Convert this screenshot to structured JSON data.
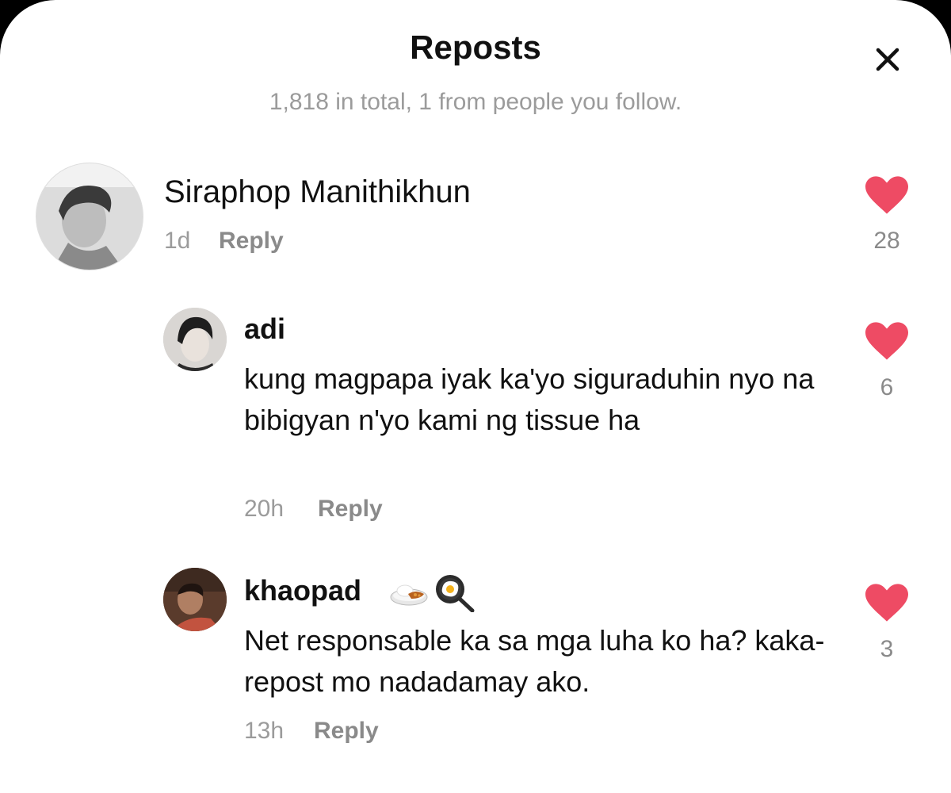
{
  "header": {
    "title": "Reposts",
    "subtitle": "1,818 in total, 1 from people you follow."
  },
  "comments": [
    {
      "username": "Siraphop Manithikhun",
      "time": "1d",
      "reply_label": "Reply",
      "likes": "28",
      "text": ""
    },
    {
      "username": "adi",
      "time": "20h",
      "reply_label": "Reply",
      "likes": "6",
      "text": "kung magpapa iyak ka'yo siguraduhin nyo na bibigyan n'yo kami ng tissue ha"
    },
    {
      "username": "khaopad",
      "username_emojis": [
        "curry-rice-emoji",
        "frying-pan-egg-emoji"
      ],
      "time": "13h",
      "reply_label": "Reply",
      "likes": "3",
      "text": "Net responsable ka sa mga luha ko ha? kaka-repost mo nadadamay ako."
    }
  ],
  "colors": {
    "heart": "#ee4b64",
    "muted_text": "#9b9b9b",
    "primary_text": "#111111"
  }
}
